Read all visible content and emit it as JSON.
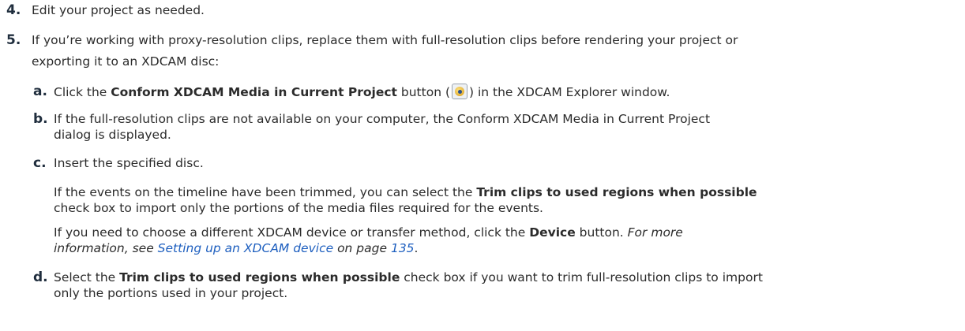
{
  "steps": {
    "s4": {
      "num": "4.",
      "text": "Edit your project as needed."
    },
    "s5": {
      "num": "5.",
      "line1": "If you’re working with proxy-resolution clips, replace them with full-resolution clips before rendering your project or",
      "line2": "exporting it to an XDCAM disc:"
    }
  },
  "subs": {
    "a": {
      "letter": "a.",
      "pre": "Click the ",
      "bold": "Conform XDCAM Media in Current Project",
      "mid": " button (",
      "post": ") in the XDCAM Explorer window.",
      "icon": "conform-media-icon"
    },
    "b": {
      "letter": "b.",
      "line1": "If the full-resolution clips are not available on your computer, the Conform XDCAM Media in Current Project",
      "line2": "dialog is displayed."
    },
    "c": {
      "letter": "c.",
      "text": "Insert the specified disc.",
      "p1_pre": "If the events on the timeline have been trimmed, you can select the ",
      "p1_bold": "Trim clips to used regions when possible",
      "p1_line2": "check box to import only the portions of the media files required for the events.",
      "p2_pre": "If you need to choose a different XDCAM device or transfer method, click the ",
      "p2_bold": "Device",
      "p2_post": " button. ",
      "p2_ital": "For more",
      "p2_line2_ital": "information, see ",
      "p2_link": "Setting up an XDCAM device",
      "p2_on_page": " on page ",
      "p2_page": "135",
      "p2_end": "."
    },
    "d": {
      "letter": "d.",
      "pre": "Select the ",
      "bold": "Trim clips to used regions when possible",
      "post": " check box if you want to trim full-resolution clips to import",
      "line2": "only the portions used in your project."
    }
  }
}
